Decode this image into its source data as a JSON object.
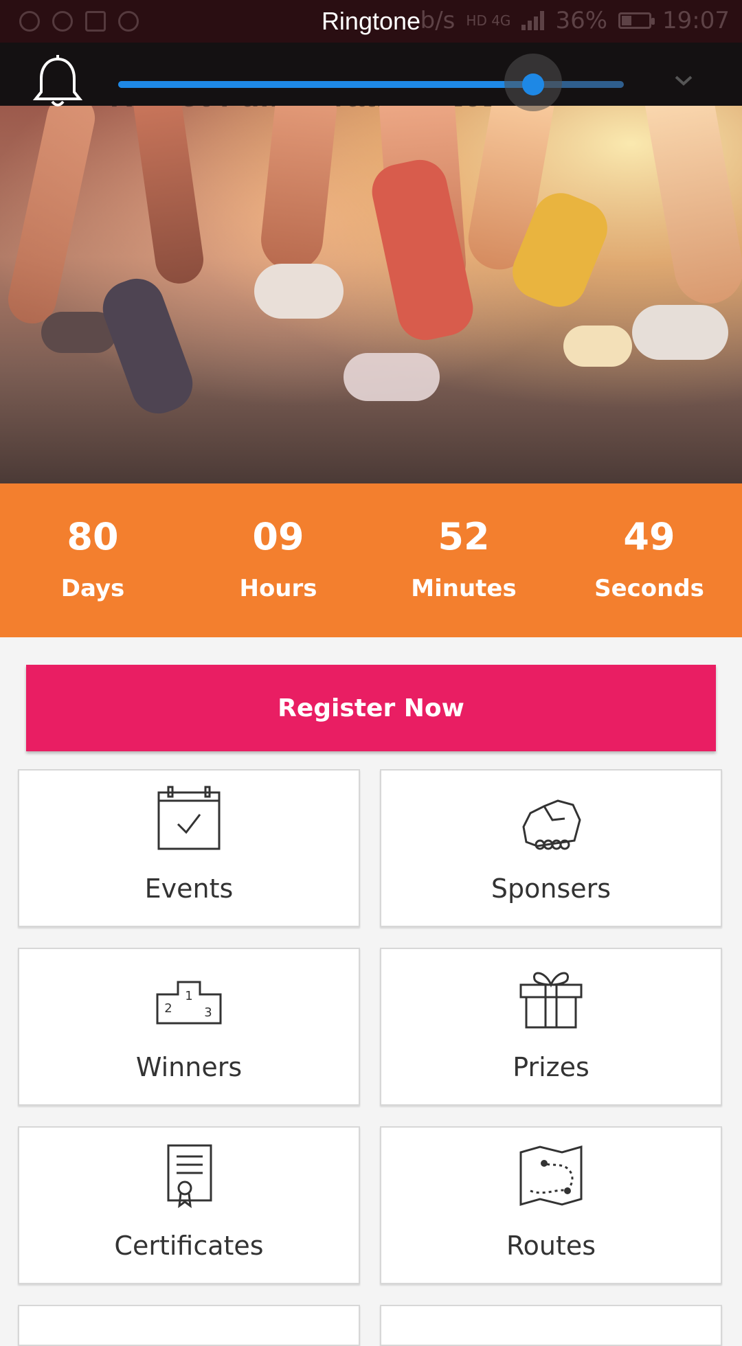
{
  "status_bar": {
    "dialog_title": "Ringtone",
    "speed_fragment": "b/s",
    "network": "HD 4G",
    "battery": "36%",
    "time": "19:07"
  },
  "volume": {
    "label_icon": "bell-icon",
    "level": 0.82
  },
  "hero": {
    "title": "Rajkot Full Marathon 2017"
  },
  "countdown": [
    {
      "value": "80",
      "label": "Days"
    },
    {
      "value": "09",
      "label": "Hours"
    },
    {
      "value": "52",
      "label": "Minutes"
    },
    {
      "value": "49",
      "label": "Seconds"
    }
  ],
  "register": {
    "label": "Register Now"
  },
  "menu": [
    {
      "label": "Events",
      "icon": "calendar-check-icon"
    },
    {
      "label": "Sponsers",
      "icon": "handshake-icon"
    },
    {
      "label": "Winners",
      "icon": "podium-icon"
    },
    {
      "label": "Prizes",
      "icon": "gift-icon"
    },
    {
      "label": "Certificates",
      "icon": "certificate-icon"
    },
    {
      "label": "Routes",
      "icon": "map-route-icon"
    }
  ],
  "colors": {
    "countdown_bg": "#f37f2e",
    "register_bg": "#e91e63",
    "slider_blue": "#1e88e5"
  }
}
